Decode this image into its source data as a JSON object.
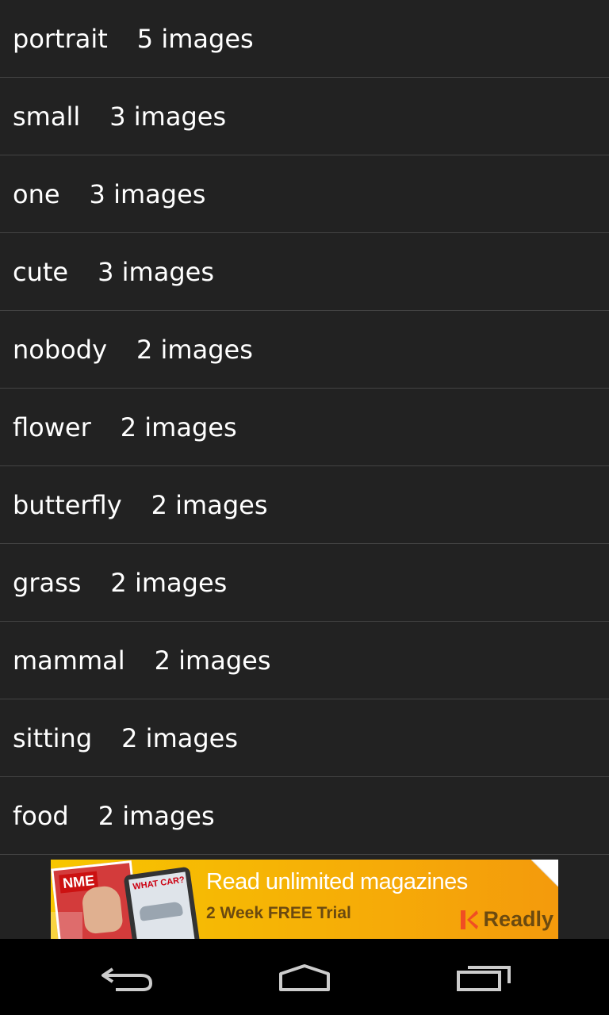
{
  "tags": [
    {
      "name": "portrait",
      "count": "5 images"
    },
    {
      "name": "small",
      "count": "3 images"
    },
    {
      "name": "one",
      "count": "3 images"
    },
    {
      "name": "cute",
      "count": "3 images"
    },
    {
      "name": "nobody",
      "count": "2 images"
    },
    {
      "name": "flower",
      "count": "2 images"
    },
    {
      "name": "butterfly",
      "count": "2 images"
    },
    {
      "name": "grass",
      "count": "2 images"
    },
    {
      "name": "mammal",
      "count": "2 images"
    },
    {
      "name": "sitting",
      "count": "2 images"
    },
    {
      "name": "food",
      "count": "2 images"
    }
  ],
  "ad": {
    "headline": "Read unlimited magazines",
    "subline": "2 Week FREE Trial",
    "brand": "Readly",
    "magazine_logo": "NME",
    "tablet_logo": "WHAT CAR?",
    "colors": {
      "background": "#f6ad07",
      "accent": "#6b4a10"
    }
  },
  "navbar": {
    "back_icon": "back-icon",
    "home_icon": "home-icon",
    "recents_icon": "recent-apps-icon"
  },
  "colors": {
    "background": "#222222",
    "divider": "#444444",
    "text": "#ffffff"
  }
}
